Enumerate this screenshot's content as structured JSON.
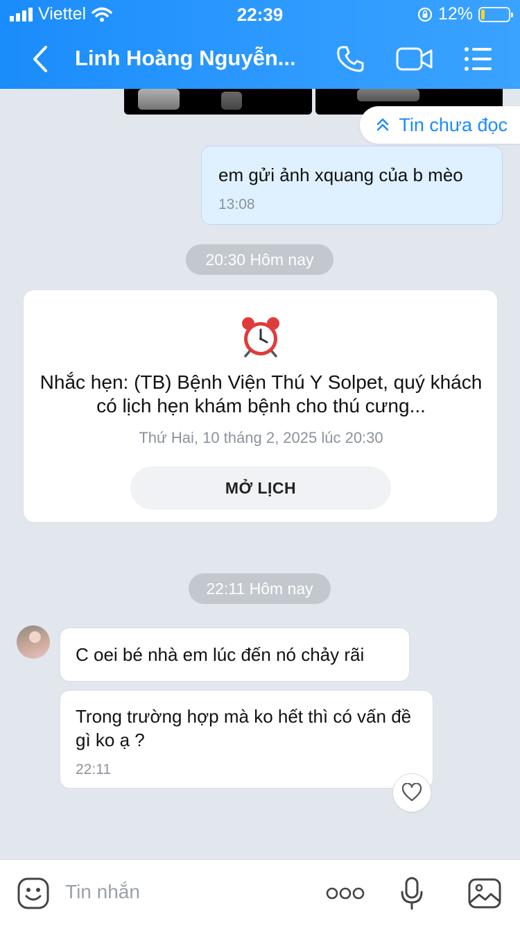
{
  "status_bar": {
    "carrier": "Viettel",
    "time": "22:39",
    "battery_percent": "12%",
    "battery_level": 0.12,
    "battery_color": "#ffd426"
  },
  "header": {
    "back_icon": "chevron-left-icon",
    "title": "Linh Hoàng Nguyễn...",
    "call_icon": "phone-icon",
    "video_icon": "video-icon",
    "menu_icon": "list-menu-icon",
    "accent": "#1a8cfb"
  },
  "unread_banner": {
    "icon": "double-chevron-up-icon",
    "label": "Tin chưa đọc"
  },
  "messages": [
    {
      "direction": "out",
      "text": "em gửi ảnh xquang của b mèo",
      "time": "13:08"
    }
  ],
  "separators": [
    {
      "label": "20:30 Hôm nay"
    },
    {
      "label": "22:11 Hôm nay"
    }
  ],
  "reminder_card": {
    "icon": "alarm-clock-icon",
    "title": "Nhắc hẹn: (TB) Bệnh Viện Thú Y Solpet, quý khách có lịch hẹn khám bệnh cho thú cưng...",
    "date": "Thứ Hai, 10 tháng 2, 2025 lúc 20:30",
    "button": "MỞ LỊCH"
  },
  "incoming": [
    {
      "text": "C oei bé nhà em lúc đến nó chảy rãi"
    },
    {
      "text": "Trong trường hợp mà ko hết thì có vấn đề gì ko ạ ?",
      "time": "22:11"
    }
  ],
  "input_bar": {
    "placeholder": "Tin nhắn",
    "emoji_icon": "sticker-icon",
    "more_icon": "more-dots-icon",
    "mic_icon": "microphone-icon",
    "image_icon": "image-icon"
  }
}
